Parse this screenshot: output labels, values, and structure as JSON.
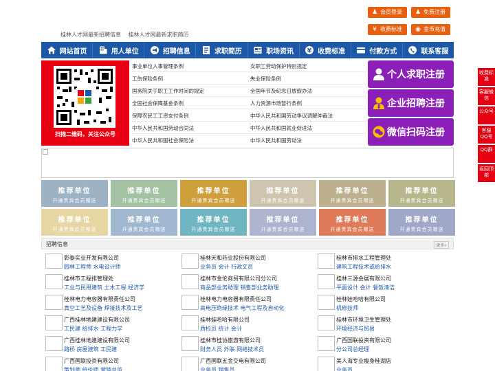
{
  "top_buttons": {
    "member_login": "会员登录",
    "free_register": "免费注册",
    "fee_standard": "收费标准",
    "gold_recharge": "金币充值"
  },
  "top_links": [
    "桂林人才网最新招聘信息",
    "桂林人才网最新求职简历"
  ],
  "nav": [
    "网站首页",
    "用人单位",
    "招聘信息",
    "求职简历",
    "职场资讯",
    "收费标准",
    "付款方式",
    "联系客服"
  ],
  "qr_caption": "扫描二维码，关注公众号",
  "laws": {
    "left": [
      "事业单位人事管理条例",
      "工伤保险条例",
      "国务院关于职工工作时间的规定",
      "全国社会保障基金条例",
      "保障农民工工资支付条例",
      "中华人民共和国劳动合同法",
      "中华人民共和国社会保险法"
    ],
    "right": [
      "女职工劳动保护特别规定",
      "失业保险条例",
      "全国年节及纪念日放假办法",
      "人力资源市场暂行条例",
      "中华人民共和国劳动争议调解仲裁法",
      "中华人民共和国就业促进法",
      "中华人民共和国劳动法"
    ]
  },
  "reg_buttons": [
    "个人求职注册",
    "企业招聘注册",
    "微信扫码注册"
  ],
  "float_items": [
    "收费标准",
    "客服微信",
    "公众号",
    "客服QQ号",
    "QQ群",
    "返回顶部"
  ],
  "tile_text": {
    "title": "推荐单位",
    "subtitle": "开通贵宾会员赠送"
  },
  "tile_colors": [
    "#9db2c4",
    "#a3c2a4",
    "#cf9f3e",
    "#cfc4ae",
    "#bcb08e",
    "#b8b68c",
    "#e7d5a4",
    "#9fb8cf",
    "#6fb6c2",
    "#aeb4cf",
    "#e07b5a",
    "#9fa8c8"
  ],
  "job_section": {
    "title": "招聘信息",
    "more": "更多»"
  },
  "jobs": [
    [
      {
        "company": "彰泰实业开发有限公司",
        "positions": "园林工程师 水电设计师"
      },
      {
        "company": "桂林市工程排管理处",
        "positions": "工业与民用建筑 土木工程 经济学"
      },
      {
        "company": "桂林电力电容器有限责任公司",
        "positions": "真空工艺及设备 焊接技术及工艺"
      },
      {
        "company": "广西桂林地建建设有限公司",
        "positions": "工民建 给排水 工程力学"
      },
      {
        "company": "广西桂林地建建设有限公司",
        "positions": "路桥 房屋建筑 工民建"
      },
      {
        "company": "广西国联投资有限公司",
        "positions": "策划师 统价师 营销总监"
      }
    ],
    [
      {
        "company": "桂林天和药业股份有限公司",
        "positions": "业务员 会计 行政文员"
      },
      {
        "company": "桂林市金伦商贸有限公司分公司",
        "positions": "商品部业务助理 销售部业务助理"
      },
      {
        "company": "桂林电力电容器有限责任公司",
        "positions": "高电压绝缘技术 电气工程及自动化"
      },
      {
        "company": "桂林娃哈哈有限公司",
        "positions": "质检员 统计 会计"
      },
      {
        "company": "桂林市桂协旅游有限公司",
        "positions": "财务人员 外联 网络技术员"
      },
      {
        "company": "广西国联五金交电有限公司",
        "positions": "业务员 销售员"
      }
    ],
    [
      {
        "company": "桂林市排水工程管理处",
        "positions": "建筑工程技术或给排水"
      },
      {
        "company": "桂林三源会展有限公司",
        "positions": "平面设计 会计 餐饭清洁"
      },
      {
        "company": "桂林娃哈哈有限公司",
        "positions": "机修技师"
      },
      {
        "company": "桂林市环境卫生管理处",
        "positions": "环境经济与贸易"
      },
      {
        "company": "广西国联投资有限公司",
        "positions": "分公司总经理"
      },
      {
        "company": "美人海专业瘦身桂湖店",
        "positions": "业务员"
      }
    ]
  ]
}
